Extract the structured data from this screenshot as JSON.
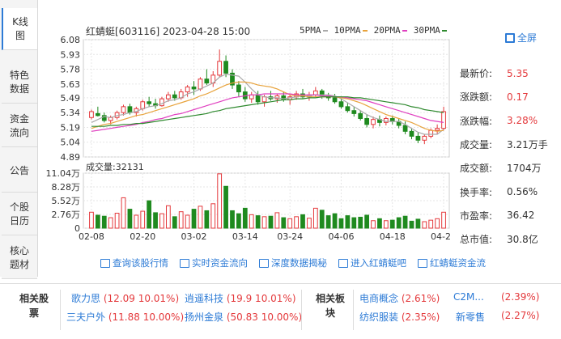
{
  "tabs": [
    {
      "label": "K线图",
      "active": true
    },
    {
      "label": "特色数据",
      "active": false
    },
    {
      "label": "资金流向",
      "active": false
    },
    {
      "label": "公告",
      "active": false
    },
    {
      "label": "个股日历",
      "active": false
    },
    {
      "label": "核心题材",
      "active": false
    }
  ],
  "header": {
    "stock_title": "红蜻蜓[603116] 2023-04-28 15:00",
    "ma": [
      {
        "label": "5PMA",
        "color": "#aaaaaa"
      },
      {
        "label": "10PMA",
        "color": "#e8a33c"
      },
      {
        "label": "20PMA",
        "color": "#e040c0"
      },
      {
        "label": "30PMA",
        "color": "#2f8a2f"
      }
    ],
    "fullscreen": "全屏"
  },
  "volume_label": "成交量:32131",
  "stats": [
    {
      "key": "最新价:",
      "value": "5.35",
      "red": true
    },
    {
      "key": "涨跌额:",
      "value": "0.17",
      "red": true
    },
    {
      "key": "涨跌幅:",
      "value": "3.28%",
      "red": true
    },
    {
      "key": "成交量:",
      "value": "3.21万手",
      "red": false
    },
    {
      "key": "成交额:",
      "value": "1704万",
      "red": false
    },
    {
      "key": "换手率:",
      "value": "0.56%",
      "red": false
    },
    {
      "key": "市盈率:",
      "value": "36.42",
      "red": false
    },
    {
      "key": "总市值:",
      "value": "30.8亿",
      "red": false
    }
  ],
  "links": [
    "查询该股行情",
    "实时资金流向",
    "深度数据揭秘",
    "进入红蜻蜓吧",
    "红蜻蜓资金流"
  ],
  "related": {
    "stocks_header": "相关股票",
    "sectors_header": "相关板块",
    "stocks": [
      {
        "name": "歌力思",
        "quote": "(12.09 10.01%)"
      },
      {
        "name": "逍遥科技",
        "quote": "(19.9 10.01%)"
      },
      {
        "name": "三夫户外",
        "quote": "(11.88 10.00%)"
      },
      {
        "name": "扬州金泉",
        "quote": "(50.83 10.00%)"
      }
    ],
    "sectors": [
      {
        "name": "电商概念",
        "quote": "(2.61%)"
      },
      {
        "name": "C2M...",
        "quote": "(2.39%)"
      },
      {
        "name": "纺织服装",
        "quote": "(2.35%)"
      },
      {
        "name": "新零售",
        "quote": "(2.27%)"
      }
    ]
  },
  "chart_data": {
    "type": "candlestick",
    "price_axis": [
      "6.08",
      "5.93",
      "5.78",
      "5.63",
      "5.49",
      "5.34",
      "5.19",
      "5.04",
      "4.89"
    ],
    "ylim": [
      4.89,
      6.08
    ],
    "volume_axis": [
      "11.04万",
      "8.28万",
      "5.52万",
      "2.76万",
      "0"
    ],
    "vol_lim": [
      0,
      11.04
    ],
    "x_ticks": [
      "02-08",
      "02-20",
      "03-02",
      "03-14",
      "03-24",
      "04-06",
      "04-18",
      "04-28"
    ],
    "ohlc": [
      [
        5.29,
        5.37,
        5.27,
        5.35
      ],
      [
        5.33,
        5.4,
        5.3,
        5.31
      ],
      [
        5.31,
        5.34,
        5.24,
        5.26
      ],
      [
        5.26,
        5.31,
        5.22,
        5.29
      ],
      [
        5.29,
        5.36,
        5.27,
        5.34
      ],
      [
        5.34,
        5.42,
        5.31,
        5.4
      ],
      [
        5.4,
        5.43,
        5.32,
        5.34
      ],
      [
        5.34,
        5.4,
        5.3,
        5.38
      ],
      [
        5.38,
        5.47,
        5.36,
        5.45
      ],
      [
        5.45,
        5.5,
        5.4,
        5.43
      ],
      [
        5.43,
        5.48,
        5.38,
        5.41
      ],
      [
        5.41,
        5.5,
        5.4,
        5.48
      ],
      [
        5.48,
        5.55,
        5.45,
        5.52
      ],
      [
        5.52,
        5.56,
        5.46,
        5.49
      ],
      [
        5.49,
        5.58,
        5.47,
        5.55
      ],
      [
        5.55,
        5.62,
        5.5,
        5.6
      ],
      [
        5.6,
        5.66,
        5.52,
        5.58
      ],
      [
        5.58,
        5.7,
        5.56,
        5.68
      ],
      [
        5.68,
        5.78,
        5.62,
        5.64
      ],
      [
        5.64,
        5.76,
        5.6,
        5.72
      ],
      [
        5.72,
        5.98,
        5.7,
        5.86
      ],
      [
        5.86,
        5.92,
        5.7,
        5.74
      ],
      [
        5.74,
        5.78,
        5.58,
        5.62
      ],
      [
        5.62,
        5.66,
        5.5,
        5.55
      ],
      [
        5.55,
        5.6,
        5.45,
        5.48
      ],
      [
        5.48,
        5.55,
        5.44,
        5.52
      ],
      [
        5.52,
        5.56,
        5.42,
        5.45
      ],
      [
        5.45,
        5.52,
        5.4,
        5.5
      ],
      [
        5.5,
        5.56,
        5.46,
        5.48
      ],
      [
        5.48,
        5.53,
        5.44,
        5.51
      ],
      [
        5.51,
        5.55,
        5.45,
        5.47
      ],
      [
        5.47,
        5.52,
        5.42,
        5.5
      ],
      [
        5.5,
        5.56,
        5.47,
        5.53
      ],
      [
        5.53,
        5.58,
        5.48,
        5.5
      ],
      [
        5.5,
        5.55,
        5.46,
        5.52
      ],
      [
        5.52,
        5.6,
        5.5,
        5.56
      ],
      [
        5.56,
        5.58,
        5.48,
        5.51
      ],
      [
        5.51,
        5.54,
        5.46,
        5.49
      ],
      [
        5.49,
        5.53,
        5.43,
        5.45
      ],
      [
        5.45,
        5.49,
        5.38,
        5.4
      ],
      [
        5.4,
        5.44,
        5.34,
        5.36
      ],
      [
        5.36,
        5.4,
        5.3,
        5.33
      ],
      [
        5.33,
        5.36,
        5.26,
        5.28
      ],
      [
        5.28,
        5.32,
        5.19,
        5.22
      ],
      [
        5.22,
        5.3,
        5.18,
        5.27
      ],
      [
        5.27,
        5.31,
        5.2,
        5.24
      ],
      [
        5.24,
        5.3,
        5.21,
        5.28
      ],
      [
        5.28,
        5.31,
        5.22,
        5.25
      ],
      [
        5.25,
        5.28,
        5.18,
        5.21
      ],
      [
        5.21,
        5.25,
        5.12,
        5.15
      ],
      [
        5.15,
        5.18,
        5.07,
        5.1
      ],
      [
        5.1,
        5.14,
        5.03,
        5.06
      ],
      [
        5.06,
        5.12,
        5.02,
        5.1
      ],
      [
        5.1,
        5.18,
        5.08,
        5.16
      ],
      [
        5.16,
        5.22,
        5.12,
        5.18
      ],
      [
        5.18,
        5.4,
        5.16,
        5.35
      ]
    ],
    "volume": [
      3.2,
      2.6,
      2.4,
      2.1,
      3.0,
      6.1,
      3.8,
      2.6,
      3.4,
      5.5,
      3.1,
      2.9,
      4.5,
      2.3,
      3.3,
      2.6,
      3.8,
      4.4,
      3.5,
      4.9,
      10.9,
      8.4,
      3.5,
      2.9,
      4.0,
      2.7,
      2.5,
      2.3,
      2.4,
      3.1,
      2.1,
      1.9,
      2.3,
      2.7,
      2.0,
      4.0,
      3.6,
      2.5,
      2.9,
      1.9,
      2.5,
      2.1,
      2.2,
      2.6,
      1.5,
      1.9,
      1.5,
      1.6,
      2.1,
      2.4,
      1.4,
      1.8,
      1.3,
      1.6,
      1.9,
      3.2
    ],
    "ma5": [
      5.24,
      5.27,
      5.3,
      5.29,
      5.31,
      5.32,
      5.34,
      5.35,
      5.38,
      5.4,
      5.41,
      5.43,
      5.46,
      5.47,
      5.49,
      5.53,
      5.55,
      5.58,
      5.61,
      5.64,
      5.7,
      5.73,
      5.72,
      5.71,
      5.65,
      5.58,
      5.52,
      5.5,
      5.49,
      5.49,
      5.48,
      5.49,
      5.5,
      5.51,
      5.51,
      5.52,
      5.52,
      5.52,
      5.51,
      5.48,
      5.44,
      5.4,
      5.36,
      5.32,
      5.29,
      5.27,
      5.25,
      5.25,
      5.25,
      5.22,
      5.18,
      5.14,
      5.12,
      5.12,
      5.12,
      5.17
    ],
    "ma10": [
      5.18,
      5.2,
      5.22,
      5.23,
      5.25,
      5.27,
      5.29,
      5.31,
      5.32,
      5.34,
      5.36,
      5.38,
      5.4,
      5.42,
      5.44,
      5.46,
      5.48,
      5.51,
      5.53,
      5.56,
      5.59,
      5.62,
      5.64,
      5.65,
      5.65,
      5.64,
      5.62,
      5.61,
      5.6,
      5.58,
      5.55,
      5.52,
      5.51,
      5.51,
      5.5,
      5.5,
      5.5,
      5.5,
      5.5,
      5.49,
      5.48,
      5.46,
      5.44,
      5.41,
      5.38,
      5.35,
      5.32,
      5.3,
      5.28,
      5.26,
      5.24,
      5.21,
      5.18,
      5.16,
      5.15,
      5.16
    ],
    "ma20": [
      5.15,
      5.16,
      5.17,
      5.18,
      5.19,
      5.2,
      5.21,
      5.22,
      5.24,
      5.25,
      5.27,
      5.28,
      5.3,
      5.32,
      5.33,
      5.35,
      5.37,
      5.39,
      5.41,
      5.43,
      5.45,
      5.47,
      5.49,
      5.5,
      5.51,
      5.52,
      5.52,
      5.53,
      5.53,
      5.53,
      5.53,
      5.53,
      5.52,
      5.52,
      5.52,
      5.52,
      5.51,
      5.51,
      5.5,
      5.5,
      5.49,
      5.48,
      5.47,
      5.46,
      5.44,
      5.42,
      5.4,
      5.38,
      5.36,
      5.34,
      5.32,
      5.3,
      5.28,
      5.26,
      5.25,
      5.24
    ],
    "ma30": [
      5.2,
      5.2,
      5.2,
      5.21,
      5.21,
      5.22,
      5.22,
      5.23,
      5.23,
      5.24,
      5.25,
      5.26,
      5.27,
      5.28,
      5.29,
      5.3,
      5.31,
      5.32,
      5.33,
      5.35,
      5.36,
      5.38,
      5.39,
      5.4,
      5.41,
      5.42,
      5.43,
      5.44,
      5.45,
      5.46,
      5.47,
      5.47,
      5.48,
      5.48,
      5.49,
      5.49,
      5.5,
      5.5,
      5.5,
      5.5,
      5.5,
      5.49,
      5.49,
      5.48,
      5.47,
      5.46,
      5.45,
      5.44,
      5.43,
      5.42,
      5.4,
      5.39,
      5.37,
      5.36,
      5.35,
      5.34
    ]
  }
}
